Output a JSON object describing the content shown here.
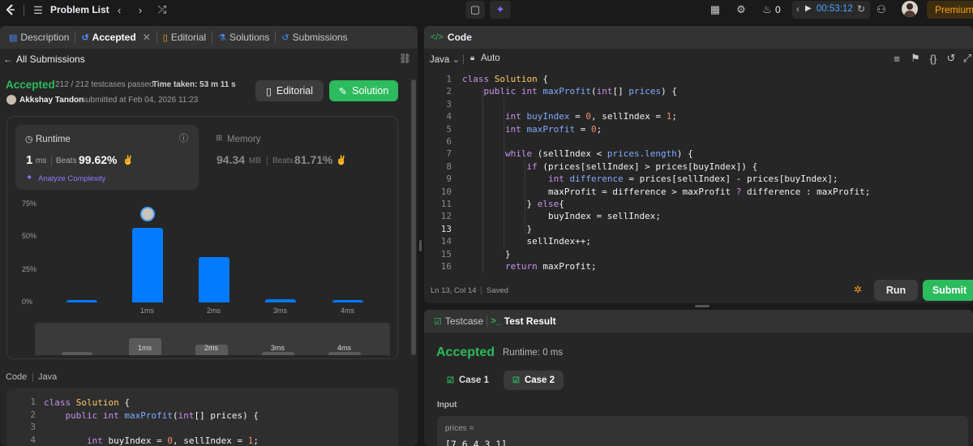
{
  "topbar": {
    "problem_list": "Problem List",
    "streak_count": "0",
    "timer": "00:53:12",
    "premium": "Premium"
  },
  "left_tabs": [
    {
      "label": "Description",
      "icon": "doc-icon"
    },
    {
      "label": "Accepted",
      "icon": "history-icon"
    },
    {
      "label": "Editorial",
      "icon": "book-icon"
    },
    {
      "label": "Solutions",
      "icon": "flask-icon"
    },
    {
      "label": "Submissions",
      "icon": "history-icon"
    }
  ],
  "submission": {
    "back_label": "All Submissions",
    "status": "Accepted",
    "testcases": "212 / 212 testcases passed",
    "time_taken_label": "Time taken: 53 m 11 s",
    "user": "Akkshay Tandon",
    "submitted_at": "submitted at Feb 04, 2026 11:23",
    "editorial_btn": "Editorial",
    "solution_btn": "Solution"
  },
  "stats": {
    "runtime_label": "Runtime",
    "runtime_value": "1",
    "runtime_unit": "ms",
    "runtime_beats_label": "Beats",
    "runtime_beats": "99.62%",
    "analyze_label": "Analyze Complexity",
    "memory_label": "Memory",
    "memory_value": "94.34",
    "memory_unit": "MB",
    "memory_beats_label": "Beats",
    "memory_beats": "81.71%"
  },
  "chart_data": {
    "type": "bar",
    "categories": [
      "",
      "1ms",
      "2ms",
      "3ms",
      "4ms"
    ],
    "values": [
      2,
      57,
      35,
      2.5,
      2
    ],
    "ylim": [
      0,
      75
    ],
    "yticks": [
      "75%",
      "50%",
      "25%",
      "0%"
    ],
    "xlabels": [
      "1ms",
      "2ms",
      "3ms",
      "4ms"
    ],
    "grid": false
  },
  "left_code": {
    "header_code": "Code",
    "header_lang": "Java",
    "lines": [
      "1",
      "2",
      "3",
      "4"
    ]
  },
  "right_code": {
    "title": "Code",
    "lang": "Java",
    "auto": "Auto",
    "status": "Ln 13, Col 14",
    "saved": "Saved",
    "run_btn": "Run",
    "submit_btn": "Submit",
    "line_numbers": [
      "1",
      "2",
      "3",
      "4",
      "5",
      "6",
      "7",
      "8",
      "9",
      "10",
      "11",
      "12",
      "13",
      "14",
      "15",
      "16"
    ]
  },
  "test": {
    "tab_testcase": "Testcase",
    "tab_result": "Test Result",
    "status": "Accepted",
    "runtime": "Runtime: 0 ms",
    "case1": "Case 1",
    "case2": "Case 2",
    "input_label": "Input",
    "param": "prices =",
    "value": "[7,6,4,3,1]"
  }
}
